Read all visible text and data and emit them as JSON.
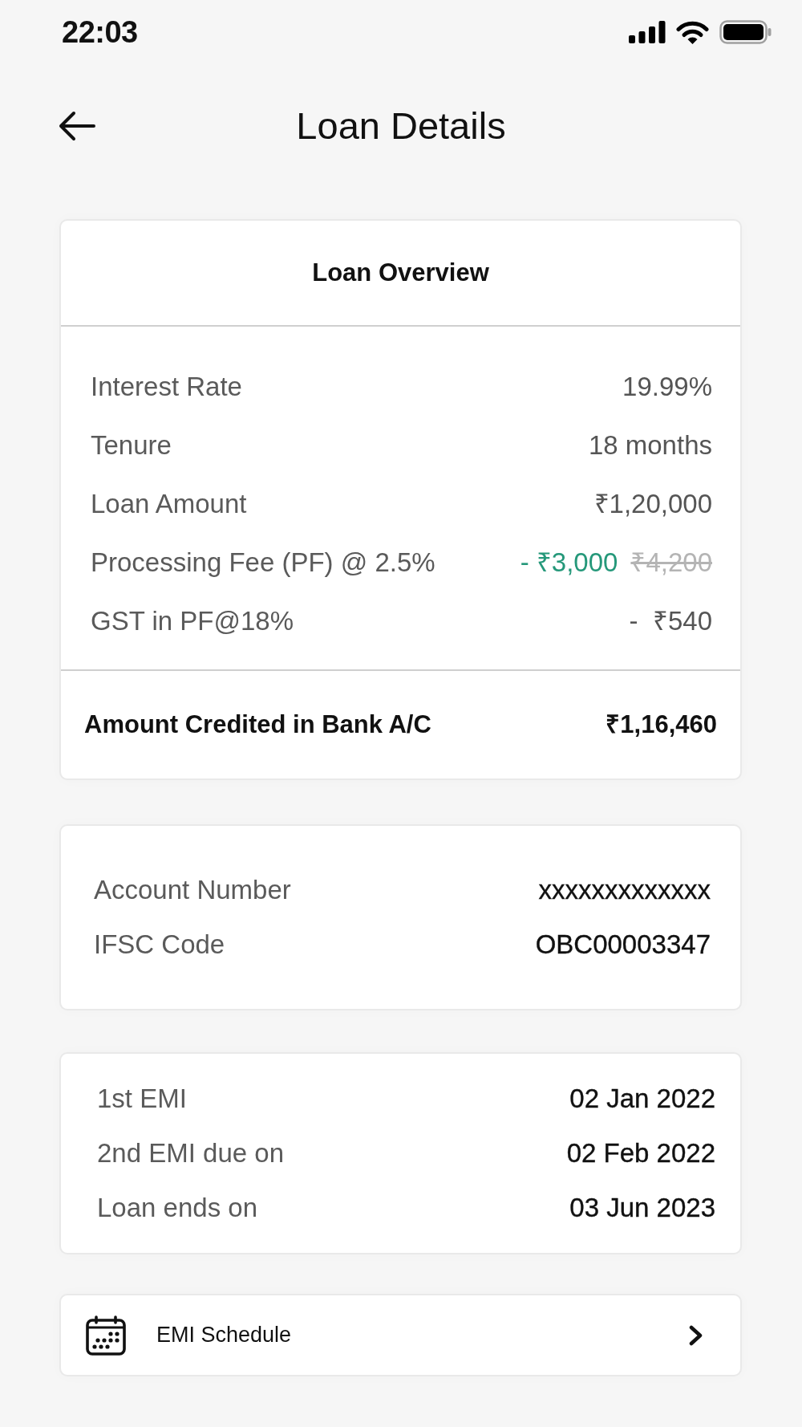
{
  "status_bar": {
    "time": "22:03"
  },
  "header": {
    "title": "Loan Details"
  },
  "overview": {
    "title": "Loan Overview",
    "rows": [
      {
        "label": "Interest Rate",
        "value": "19.99%",
        "kind": "plain"
      },
      {
        "label": "Tenure",
        "value": "18 months",
        "kind": "plain"
      },
      {
        "label": "Loan Amount",
        "value": "₹1,20,000",
        "kind": "plain"
      },
      {
        "label": "Processing Fee (PF) @ 2.5%",
        "value": "- ₹3,000",
        "original_value": "₹4,200",
        "kind": "discount"
      },
      {
        "label": "GST in PF@18%",
        "value": "-  ₹540",
        "kind": "plain"
      }
    ],
    "total": {
      "label": "Amount Credited in Bank A/C",
      "value": "₹1,16,460"
    }
  },
  "bank_account": {
    "rows": [
      {
        "label": "Account Number",
        "value": "xxxxxxxxxxxxx"
      },
      {
        "label": "IFSC Code",
        "value": "OBC00003347"
      }
    ]
  },
  "emi_dates": {
    "rows": [
      {
        "label": "1st EMI",
        "value": "02 Jan 2022"
      },
      {
        "label": "2nd EMI due on",
        "value": "02 Feb 2022"
      },
      {
        "label": "Loan ends on",
        "value": "03 Jun 2023"
      }
    ]
  },
  "emi_schedule_link": {
    "label": "EMI Schedule"
  }
}
